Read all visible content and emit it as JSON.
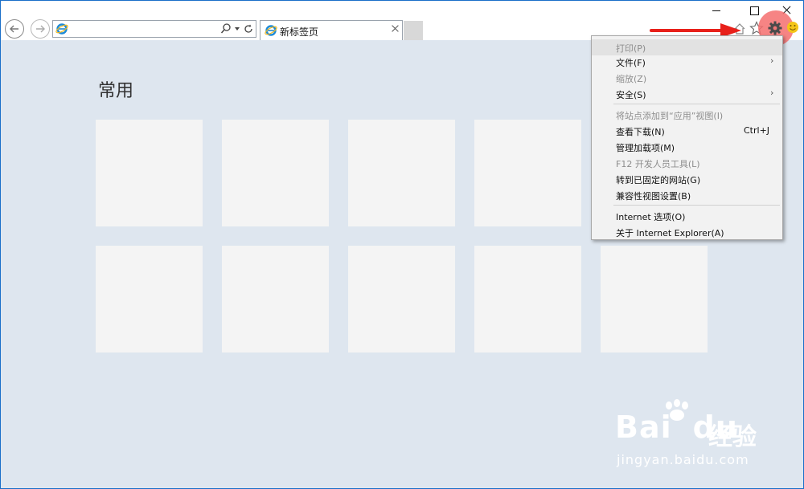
{
  "tab": {
    "title": "新标签页"
  },
  "address": {
    "value": ""
  },
  "content": {
    "section_title": "常用",
    "tile_count": 10
  },
  "menu": {
    "items": [
      {
        "label": "打印(P)",
        "disabled": true,
        "highlighted": true,
        "submenu": false,
        "shortcut": ""
      },
      {
        "label": "文件(F)",
        "disabled": false,
        "submenu": true,
        "shortcut": ""
      },
      {
        "label": "缩放(Z)",
        "disabled": true,
        "submenu": false,
        "shortcut": ""
      },
      {
        "label": "安全(S)",
        "disabled": false,
        "submenu": true,
        "shortcut": ""
      },
      {
        "label": "将站点添加到“应用”视图(I)",
        "disabled": true,
        "submenu": false,
        "shortcut": ""
      },
      {
        "label": "查看下载(N)",
        "disabled": false,
        "submenu": false,
        "shortcut": "Ctrl+J"
      },
      {
        "label": "管理加载项(M)",
        "disabled": false,
        "submenu": false,
        "shortcut": ""
      },
      {
        "label": "F12 开发人员工具(L)",
        "disabled": true,
        "submenu": false,
        "shortcut": ""
      },
      {
        "label": "转到已固定的网站(G)",
        "disabled": false,
        "submenu": false,
        "shortcut": ""
      },
      {
        "label": "兼容性视图设置(B)",
        "disabled": false,
        "submenu": false,
        "shortcut": ""
      },
      {
        "label": "Internet 选项(O)",
        "disabled": false,
        "submenu": false,
        "shortcut": ""
      },
      {
        "label": "关于 Internet Explorer(A)",
        "disabled": false,
        "submenu": false,
        "shortcut": ""
      }
    ],
    "submenu_glyph": "›"
  },
  "watermark": {
    "brand": "Bai",
    "brand2": "du",
    "cn": "经验",
    "url": "jingyan.baidu.com"
  },
  "colors": {
    "accent": "#1a6fc9",
    "highlight": "#f46e6e",
    "arrow": "#e8201a",
    "background": "#dee6ef"
  }
}
